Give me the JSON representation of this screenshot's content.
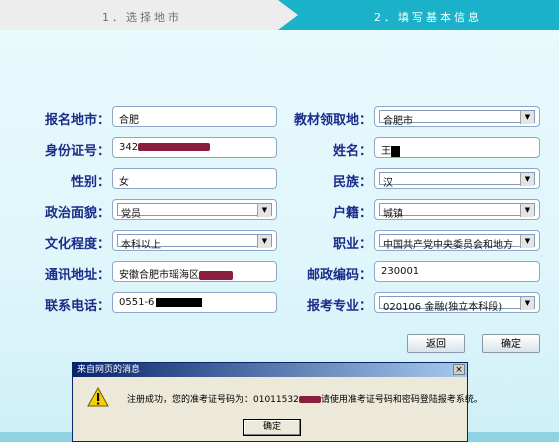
{
  "steps": {
    "step1": "1．选择地市",
    "step2": "2．填写基本信息"
  },
  "form": {
    "exam_city_label": "报名地市：",
    "exam_city_value": "合肥",
    "material_place_label": "教材领取地：",
    "material_place_value": "合肥市",
    "id_label": "身份证号：",
    "id_value_prefix": "342",
    "name_label": "姓名：",
    "name_value_prefix": "王",
    "gender_label": "性别：",
    "gender_value": "女",
    "ethnicity_label": "民族：",
    "ethnicity_value": "汉",
    "political_label": "政治面貌：",
    "political_value": "党员",
    "household_label": "户籍：",
    "household_value": "城镇",
    "education_label": "文化程度：",
    "education_value": "本科以上",
    "occupation_label": "职业：",
    "occupation_value": "中国共产党中央委员会和地方",
    "address_label": "通讯地址：",
    "address_value_prefix": "安徽合肥市瑶海区",
    "postcode_label": "邮政编码：",
    "postcode_value": "230001",
    "phone_label": "联系电话：",
    "phone_value_prefix": "0551-6",
    "major_label": "报考专业：",
    "major_value": "020106 金融(独立本科段)"
  },
  "buttons": {
    "back": "返回",
    "confirm": "确定"
  },
  "dialog": {
    "title": "来自网页的消息",
    "close": "×",
    "message_prefix": "注册成功，您的准考证号码为：01011532",
    "message_suffix": "请使用准考证号码和密码登陆报考系统。",
    "ok": "确定"
  },
  "colors": {
    "label": "#1a2b8a",
    "active_step": "#1bb1c8",
    "redaction": "#8b1d3e"
  }
}
